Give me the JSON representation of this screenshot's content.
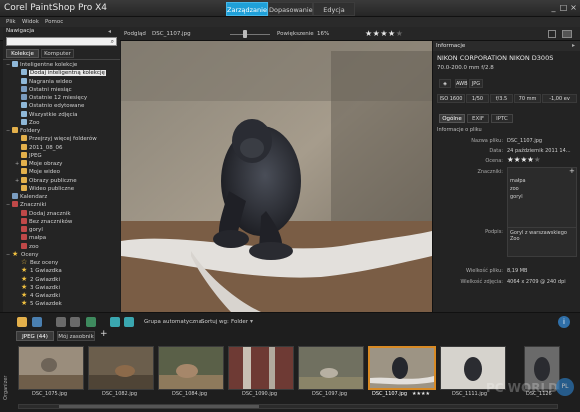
{
  "app": {
    "title": "Corel PaintShop Pro X4",
    "tabs": [
      "Zarządzanie",
      "Dopasowanie",
      "Edycja"
    ],
    "active_tab": "Zarządzanie",
    "window_buttons": [
      "_",
      "□",
      "×"
    ]
  },
  "menu": [
    "Plik",
    "Widok",
    "Pomoc"
  ],
  "topbar": {
    "preview_label": "Podgląd",
    "filename": "DSC_1107.jpg",
    "zoom_label": "Powiększenie",
    "zoom_value": "16%",
    "rating_stars": 4
  },
  "nav": {
    "title": "Nawigacja",
    "tabs": [
      "Kolekcje",
      "Komputer"
    ],
    "search_placeholder": ""
  },
  "tree": [
    {
      "label": "Inteligentne kolekcje",
      "level": 0,
      "icon": "smart-collection-icon",
      "expand": "−"
    },
    {
      "label": "Dodaj inteligentną kolekcję",
      "level": 1,
      "icon": "add-icon",
      "selected": true
    },
    {
      "label": "Nagrania wideo",
      "level": 1,
      "icon": "video-icon"
    },
    {
      "label": "Ostatni miesiąc",
      "level": 1,
      "icon": "calendar-icon"
    },
    {
      "label": "Ostatnie 12 miesięcy",
      "level": 1,
      "icon": "calendar-icon"
    },
    {
      "label": "Ostatnio edytowane",
      "level": 1,
      "icon": "edit-icon"
    },
    {
      "label": "Wszystkie zdjęcia",
      "level": 1,
      "icon": "photos-icon"
    },
    {
      "label": "Zoo",
      "level": 1,
      "icon": "collection-icon"
    },
    {
      "label": "Foldery",
      "level": 0,
      "icon": "folder-icon",
      "expand": "−"
    },
    {
      "label": "Przejrzyj więcej folderów",
      "level": 1,
      "icon": "folder-icon"
    },
    {
      "label": "2011_08_06",
      "level": 1,
      "icon": "folder-icon"
    },
    {
      "label": "JPEG",
      "level": 1,
      "icon": "folder-icon"
    },
    {
      "label": "Moje obrazy",
      "level": 1,
      "icon": "folder-icon",
      "expand": "+"
    },
    {
      "label": "Moje wideo",
      "level": 1,
      "icon": "folder-icon"
    },
    {
      "label": "Obrazy publiczne",
      "level": 1,
      "icon": "folder-icon",
      "expand": "+"
    },
    {
      "label": "Wideo publiczne",
      "level": 1,
      "icon": "folder-icon"
    },
    {
      "label": "Kalendarz",
      "level": 0,
      "icon": "calendar-icon"
    },
    {
      "label": "Znaczniki",
      "level": 0,
      "icon": "tag-icon",
      "expand": "−"
    },
    {
      "label": "Dodaj znacznik",
      "level": 1,
      "icon": "tag-icon"
    },
    {
      "label": "Bez znaczników",
      "level": 1,
      "icon": "tag-icon"
    },
    {
      "label": "goryl",
      "level": 1,
      "icon": "tag-icon"
    },
    {
      "label": "małpa",
      "level": 1,
      "icon": "tag-icon"
    },
    {
      "label": "zoo",
      "level": 1,
      "icon": "tag-icon"
    },
    {
      "label": "Oceny",
      "level": 0,
      "icon": "star-icon",
      "expand": "−"
    },
    {
      "label": "Bez oceny",
      "level": 1,
      "icon": "star-outline-icon"
    },
    {
      "label": "1 Gwiazdka",
      "level": 1,
      "icon": "star-icon"
    },
    {
      "label": "2 Gwiazdki",
      "level": 1,
      "icon": "star-icon"
    },
    {
      "label": "3 Gwiazdki",
      "level": 1,
      "icon": "star-icon"
    },
    {
      "label": "4 Gwiazdki",
      "level": 1,
      "icon": "star-icon"
    },
    {
      "label": "5 Gwiazdek",
      "level": 1,
      "icon": "star-icon"
    }
  ],
  "info": {
    "title": "Informacje",
    "camera": "NIKON CORPORATION NIKON D300S",
    "lens": "70.0-200.0 mm f/2.8",
    "badges": [
      "AWB",
      "JPG"
    ],
    "exif_row": [
      "ISO 1600",
      "1/50",
      "f/3.5",
      "70 mm",
      "-1,00 ev"
    ],
    "tabs": [
      "Ogólne",
      "EXIF",
      "IPTC"
    ],
    "section": "Informacje o pliku",
    "filename_label": "Nazwa pliku:",
    "filename": "DSC_1107.jpg",
    "date_label": "Data:",
    "date": "24 październik 2011 14...",
    "rating_label": "Ocena:",
    "rating": 4,
    "tags_label": "Znaczniki:",
    "tags": [
      "małpa",
      "zoo",
      "goryl"
    ],
    "caption_label": "Podpis:",
    "caption": "Goryl z warszawskiego Zoo",
    "filesize_label": "Wielkość pliku:",
    "filesize": "8,19 MB",
    "imagesize_label": "Wielkość zdjęcia:",
    "imagesize": "4064 x 2709 @ 240 dpi"
  },
  "bottom": {
    "toolbar": {
      "group_label": "Grupa automatyczna",
      "sort_label": "Sortuj wg:",
      "sort_value": "Folder"
    },
    "tabs": [
      "JPEG (44)",
      "Mój zasobnik"
    ],
    "add_tab": "+",
    "organizer_label": "Organizer",
    "thumbnails": [
      "DSC_1075.jpg",
      "DSC_1082.jpg",
      "DSC_1084.jpg",
      "DSC_1090.jpg",
      "DSC_1097.jpg",
      "DSC_1107.jpg",
      "DSC_1111.jpg",
      "DSC_1126"
    ],
    "selected_thumb_stars": "★★★★",
    "watermark": "PC WORLD"
  }
}
